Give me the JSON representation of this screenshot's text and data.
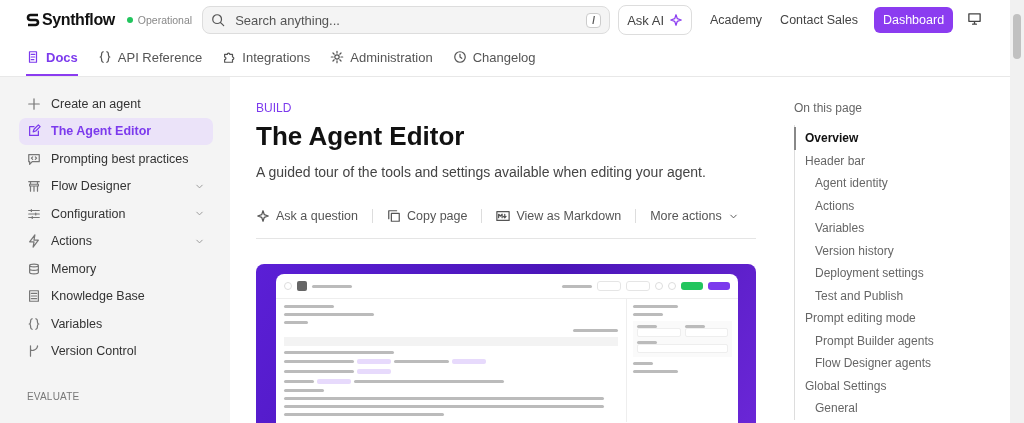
{
  "header": {
    "logo": "Synthflow",
    "status": "Operational",
    "search": {
      "placeholder": "Search anything...",
      "shortcut": "/"
    },
    "ask_ai": "Ask AI",
    "links": [
      "Academy",
      "Contact Sales"
    ],
    "dashboard": "Dashboard"
  },
  "tabs": [
    {
      "label": "Docs",
      "selected": true
    },
    {
      "label": "API Reference",
      "selected": false
    },
    {
      "label": "Integrations",
      "selected": false
    },
    {
      "label": "Administration",
      "selected": false
    },
    {
      "label": "Changelog",
      "selected": false
    }
  ],
  "sidebar": {
    "items": [
      {
        "label": "Create an agent",
        "selected": false,
        "expandable": false
      },
      {
        "label": "The Agent Editor",
        "selected": true,
        "expandable": false
      },
      {
        "label": "Prompting best practices",
        "selected": false,
        "expandable": false
      },
      {
        "label": "Flow Designer",
        "selected": false,
        "expandable": true
      },
      {
        "label": "Configuration",
        "selected": false,
        "expandable": true
      },
      {
        "label": "Actions",
        "selected": false,
        "expandable": true
      },
      {
        "label": "Memory",
        "selected": false,
        "expandable": false
      },
      {
        "label": "Knowledge Base",
        "selected": false,
        "expandable": false
      },
      {
        "label": "Variables",
        "selected": false,
        "expandable": false
      },
      {
        "label": "Version Control",
        "selected": false,
        "expandable": false
      }
    ],
    "section": "EVALUATE"
  },
  "article": {
    "eyebrow": "BUILD",
    "title": "The Agent Editor",
    "subtitle": "A guided tour of the tools and settings available when editing your agent.",
    "actions": [
      "Ask a question",
      "Copy page",
      "View as Markdown",
      "More actions"
    ]
  },
  "toc": {
    "title": "On this page",
    "items": [
      {
        "label": "Overview",
        "selected": true
      },
      {
        "label": "Header bar",
        "selected": false,
        "children": [
          {
            "label": "Agent identity",
            "selected": false
          },
          {
            "label": "Actions",
            "selected": false
          },
          {
            "label": "Variables",
            "selected": false
          },
          {
            "label": "Version history",
            "selected": false
          },
          {
            "label": "Deployment settings",
            "selected": false
          },
          {
            "label": "Test and Publish",
            "selected": false
          }
        ]
      },
      {
        "label": "Prompt editing mode",
        "selected": false,
        "children": [
          {
            "label": "Prompt Builder agents",
            "selected": false
          },
          {
            "label": "Flow Designer agents",
            "selected": false
          }
        ]
      },
      {
        "label": "Global Settings",
        "selected": false,
        "children": [
          {
            "label": "General",
            "selected": false
          }
        ]
      }
    ]
  }
}
